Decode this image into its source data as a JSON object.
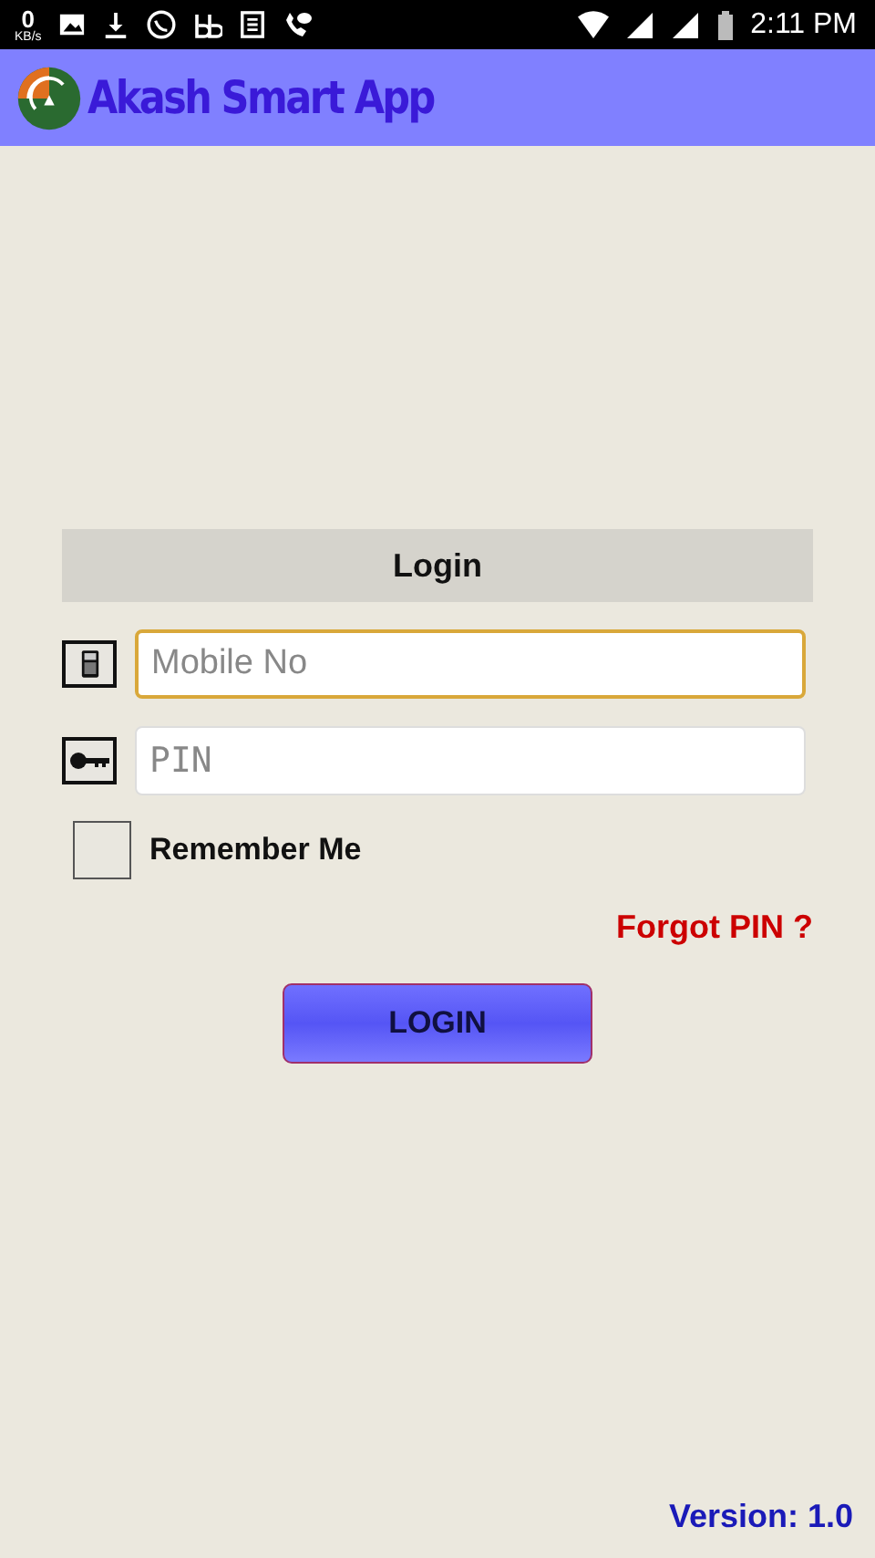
{
  "status_bar": {
    "speed_value": "0",
    "speed_unit": "KB/s",
    "time": "2:11 PM"
  },
  "app_bar": {
    "title": "Akash Smart App"
  },
  "login_form": {
    "heading": "Login",
    "fields": [
      {
        "kind": "mobile",
        "placeholder": "Mobile No",
        "focused": true
      },
      {
        "kind": "pin",
        "placeholder": "PIN",
        "focused": false
      }
    ],
    "remember": {
      "label": "Remember Me",
      "checked": false
    },
    "forgot_link": "Forgot PIN ?",
    "submit": "LOGIN"
  },
  "version": "Version: 1.0"
}
